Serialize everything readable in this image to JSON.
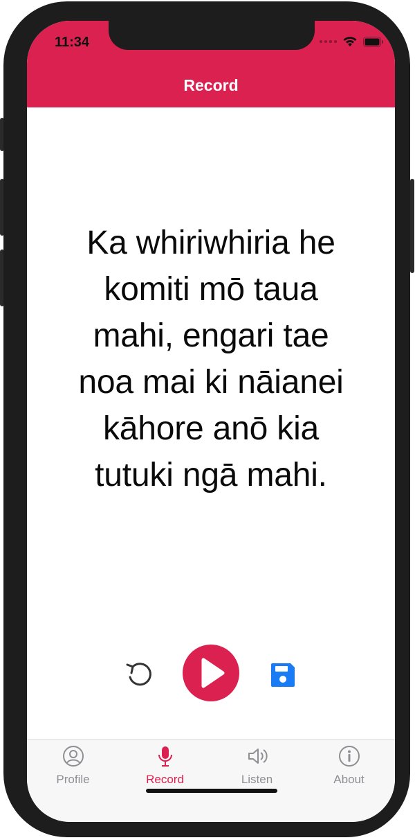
{
  "status_bar": {
    "time": "11:34"
  },
  "header": {
    "title": "Record"
  },
  "sentence": {
    "lines": [
      "Ka whiriwhiria he",
      "komiti mō taua",
      "mahi, engari tae",
      "noa mai ki nāianei",
      "kāhore anō kia",
      "tutuki ngā mahi."
    ]
  },
  "controls": {
    "undo_icon": "undo-icon",
    "play_icon": "play-icon",
    "save_icon": "floppy-disk-icon"
  },
  "tabs": [
    {
      "label": "Profile",
      "icon": "person-circle-icon",
      "active": false
    },
    {
      "label": "Record",
      "icon": "microphone-icon",
      "active": true
    },
    {
      "label": "Listen",
      "icon": "speaker-icon",
      "active": false
    },
    {
      "label": "About",
      "icon": "info-circle-icon",
      "active": false
    }
  ],
  "colors": {
    "accent": "#db2150",
    "save": "#1a7cf5",
    "inactive": "#8e8e93"
  }
}
